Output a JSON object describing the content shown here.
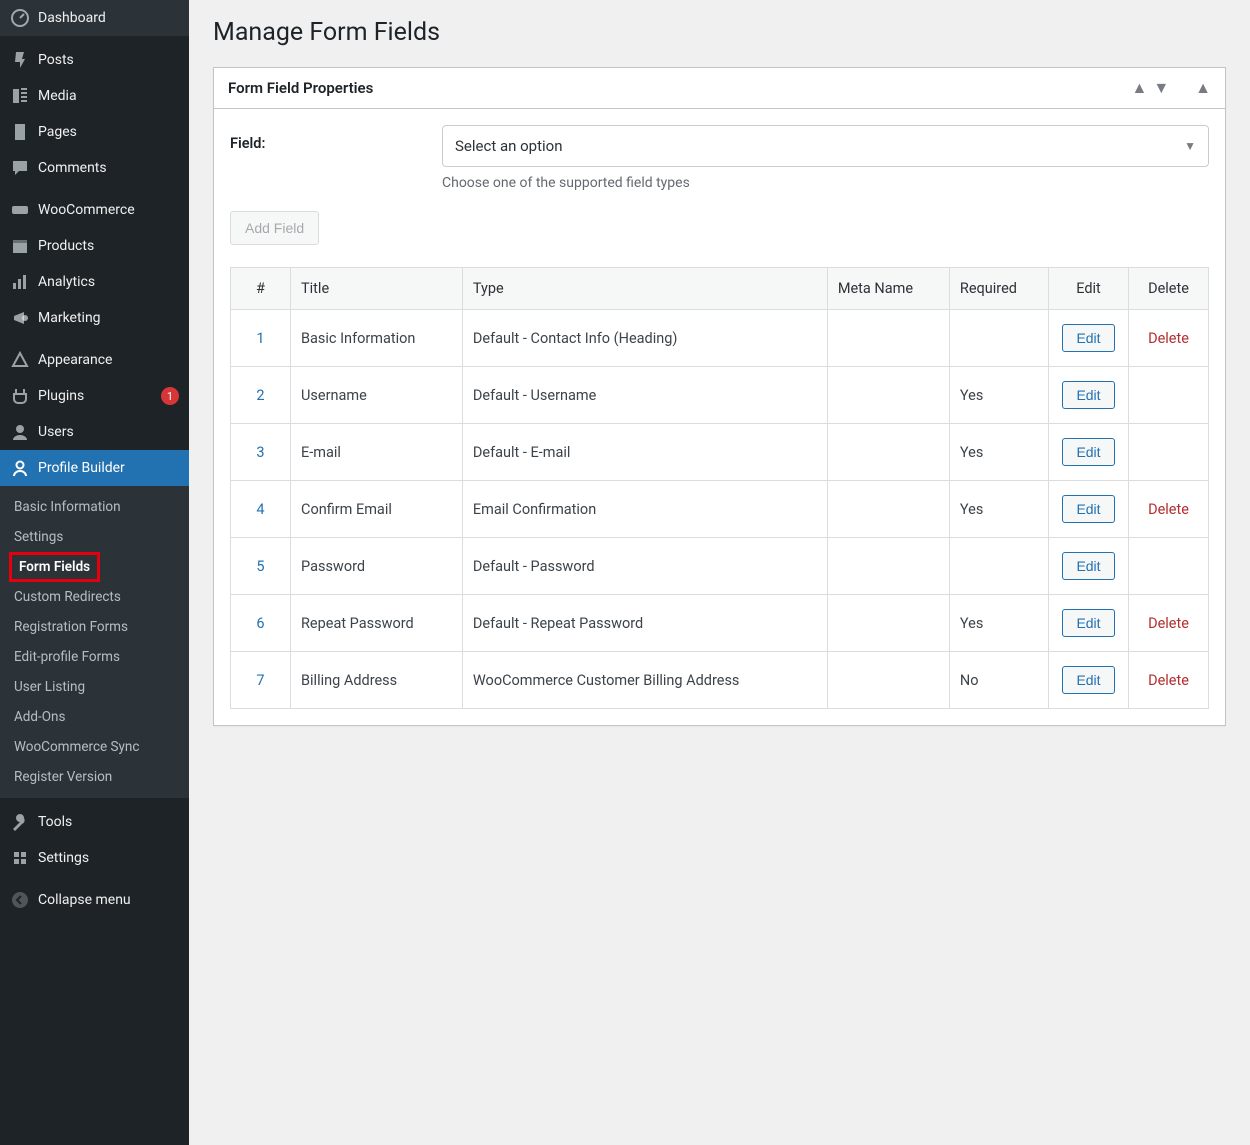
{
  "sidebar": {
    "items": [
      {
        "icon": "dashboard",
        "label": "Dashboard"
      },
      {
        "icon": "pin",
        "label": "Posts",
        "gap": true
      },
      {
        "icon": "media",
        "label": "Media"
      },
      {
        "icon": "page",
        "label": "Pages"
      },
      {
        "icon": "comment",
        "label": "Comments"
      },
      {
        "icon": "woo",
        "label": "WooCommerce",
        "gap": true
      },
      {
        "icon": "products",
        "label": "Products"
      },
      {
        "icon": "analytics",
        "label": "Analytics"
      },
      {
        "icon": "marketing",
        "label": "Marketing"
      },
      {
        "icon": "appearance",
        "label": "Appearance",
        "gap": true
      },
      {
        "icon": "plugins",
        "label": "Plugins",
        "badge": "1"
      },
      {
        "icon": "users",
        "label": "Users"
      },
      {
        "icon": "profile",
        "label": "Profile Builder",
        "active": true
      },
      {
        "icon": "tools",
        "label": "Tools",
        "gap": true
      },
      {
        "icon": "settings",
        "label": "Settings"
      },
      {
        "icon": "collapse",
        "label": "Collapse menu",
        "gap": true
      }
    ],
    "submenu": [
      {
        "label": "Basic Information"
      },
      {
        "label": "Settings"
      },
      {
        "label": "Form Fields",
        "current": true,
        "highlighted": true
      },
      {
        "label": "Custom Redirects"
      },
      {
        "label": "Registration Forms"
      },
      {
        "label": "Edit-profile Forms"
      },
      {
        "label": "User Listing"
      },
      {
        "label": "Add-Ons"
      },
      {
        "label": "WooCommerce Sync"
      },
      {
        "label": "Register Version"
      }
    ]
  },
  "page": {
    "title": "Manage Form Fields",
    "postbox_title": "Form Field Properties",
    "field_label": "Field:",
    "select_placeholder": "Select an option",
    "field_help": "Choose one of the supported field types",
    "add_field_btn": "Add Field"
  },
  "table": {
    "headers": {
      "num": "#",
      "title": "Title",
      "type": "Type",
      "meta": "Meta Name",
      "required": "Required",
      "edit": "Edit",
      "delete": "Delete"
    },
    "edit_label": "Edit",
    "delete_label": "Delete",
    "rows": [
      {
        "num": "1",
        "title": "Basic Information",
        "type": "Default - Contact Info (Heading)",
        "meta": "",
        "required": "",
        "deletable": true
      },
      {
        "num": "2",
        "title": "Username",
        "type": "Default - Username",
        "meta": "",
        "required": "Yes",
        "deletable": false
      },
      {
        "num": "3",
        "title": "E-mail",
        "type": "Default - E-mail",
        "meta": "",
        "required": "Yes",
        "deletable": false
      },
      {
        "num": "4",
        "title": "Confirm Email",
        "type": "Email Confirmation",
        "meta": "",
        "required": "Yes",
        "deletable": true
      },
      {
        "num": "5",
        "title": "Password",
        "type": "Default - Password",
        "meta": "",
        "required": "",
        "deletable": false
      },
      {
        "num": "6",
        "title": "Repeat Password",
        "type": "Default - Repeat Password",
        "meta": "",
        "required": "Yes",
        "deletable": true
      },
      {
        "num": "7",
        "title": "Billing Address",
        "type": "WooCommerce Customer Billing Address",
        "meta": "",
        "required": "No",
        "deletable": true
      }
    ]
  }
}
